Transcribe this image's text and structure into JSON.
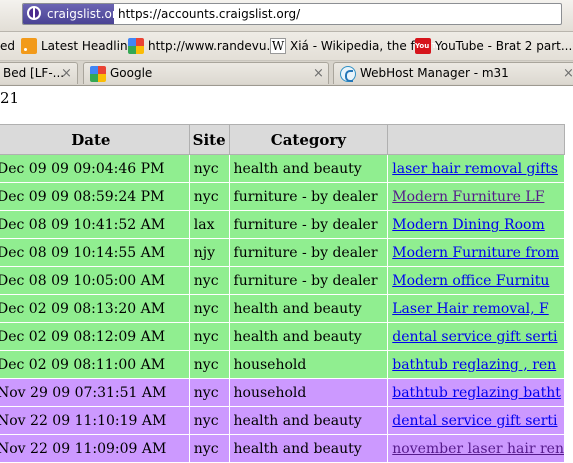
{
  "address_bar": {
    "site_identity": "craigslist.org",
    "url": "https://accounts.craigslist.org/"
  },
  "bookmarks": [
    {
      "label": "ed",
      "icon": ""
    },
    {
      "label": "Latest Headlines",
      "icon": "rss-icon"
    },
    {
      "label": "http://www.randevu....",
      "icon": "google-icon"
    },
    {
      "label": "Xiá - Wikipedia, the fr...",
      "icon": "wikipedia-icon"
    },
    {
      "label": "YouTube - Brat 2 part...",
      "icon": "youtube-icon"
    }
  ],
  "youtube_icon_text": "You Tube",
  "wikipedia_icon_text": "W",
  "tabs": [
    {
      "label": "Bed [LF-...",
      "close": "×"
    },
    {
      "label": "Google",
      "close": "×"
    },
    {
      "label": "WebHost Manager - m31",
      "close": "×"
    }
  ],
  "result_count": "21",
  "table": {
    "headers": [
      "Date",
      "Site",
      "Category",
      ""
    ],
    "rows": [
      {
        "date": "Dec 09 09 09:04:46 PM",
        "site": "nyc",
        "category": "health and beauty",
        "title": "laser hair removal gifts",
        "color": "green",
        "visited": false
      },
      {
        "date": "Dec 09 09 08:59:24 PM",
        "site": "nyc",
        "category": "furniture - by dealer",
        "title": "Modern Furniture LF",
        "color": "green",
        "visited": true
      },
      {
        "date": "Dec 08 09 10:41:52 AM",
        "site": "lax",
        "category": "furniture - by dealer",
        "title": "Modern Dining Room",
        "color": "green",
        "visited": false
      },
      {
        "date": "Dec 08 09 10:14:55 AM",
        "site": "njy",
        "category": "furniture - by dealer",
        "title": "Modern Furniture from",
        "color": "green",
        "visited": false
      },
      {
        "date": "Dec 08 09 10:05:00 AM",
        "site": "nyc",
        "category": "furniture - by dealer",
        "title": "Modern office Furnitu",
        "color": "green",
        "visited": false
      },
      {
        "date": "Dec 02 09 08:13:20 AM",
        "site": "nyc",
        "category": "health and beauty",
        "title": "Laser Hair removal, F",
        "color": "green",
        "visited": false
      },
      {
        "date": "Dec 02 09 08:12:09 AM",
        "site": "nyc",
        "category": "health and beauty",
        "title": "dental service gift serti",
        "color": "green",
        "visited": false
      },
      {
        "date": "Dec 02 09 08:11:00 AM",
        "site": "nyc",
        "category": "household",
        "title": "bathtub reglazing , ren",
        "color": "green",
        "visited": false
      },
      {
        "date": "Nov 29 09 07:31:51 AM",
        "site": "nyc",
        "category": "household",
        "title": "bathtub reglazing batht",
        "color": "purple",
        "visited": false
      },
      {
        "date": "Nov 22 09 11:10:19 AM",
        "site": "nyc",
        "category": "health and beauty",
        "title": "dental service gift serti",
        "color": "purple",
        "visited": false
      },
      {
        "date": "Nov 22 09 11:09:09 AM",
        "site": "nyc",
        "category": "health and beauty",
        "title": "november laser hair ren",
        "color": "purple",
        "visited": true
      }
    ]
  },
  "colors": {
    "active_row": "#90ee90",
    "expired_row": "#cc99ff",
    "link": "#0000ee",
    "visited_link": "#551a8b"
  }
}
